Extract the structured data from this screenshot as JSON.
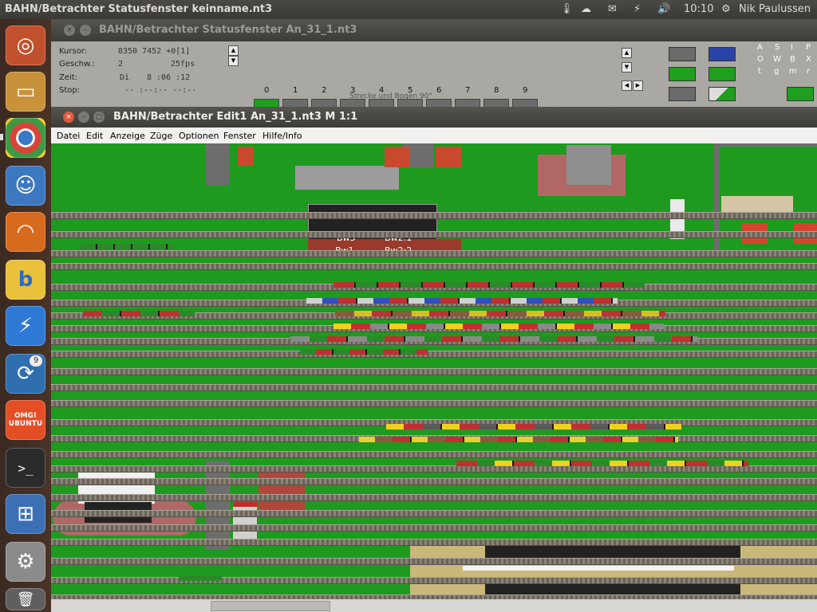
{
  "topbar": {
    "title": "BAHN/Betrachter Statusfenster keinname.nt3",
    "time": "10:10",
    "user": "Nik Paulussen"
  },
  "launcher": {
    "items": [
      {
        "name": "ubuntu-icon",
        "color": "#c1502c"
      },
      {
        "name": "files-icon",
        "color": "#c8923b"
      },
      {
        "name": "chrome-icon",
        "color": "#d9443a"
      },
      {
        "name": "mail-stamp-icon",
        "color": "#3c78c0"
      },
      {
        "name": "rss-icon",
        "color": "#d86a1e"
      },
      {
        "name": "b-app-icon",
        "color": "#e9c13b"
      },
      {
        "name": "bolt-app-icon",
        "color": "#2e79d4"
      },
      {
        "name": "chat-app-icon",
        "color": "#2f6fb0"
      },
      {
        "name": "omg-ubuntu-icon",
        "color": "#e54e24"
      },
      {
        "name": "terminal-icon",
        "color": "#2b2b2b"
      },
      {
        "name": "workspaces-icon",
        "color": "#3d6fb5"
      },
      {
        "name": "settings-icon",
        "color": "#8a8a8a"
      },
      {
        "name": "trash-icon",
        "color": "#5f5f5f"
      }
    ],
    "chat_badge": "9",
    "omg_label": "OMG! UBUNTU"
  },
  "statuswin": {
    "title": "BAHN/Betrachter Statusfenster An_31_1.nt3",
    "labels": {
      "kursor": "Kursor:",
      "geschw": "Geschw.:",
      "zeit": "Zeit:",
      "stop": "Stop:"
    },
    "values": {
      "kursor": "8350  7452 +0[1]",
      "geschw": "2",
      "fps": "25fps",
      "zeit_day": "Di",
      "zeit_time": "8 :06  :12",
      "stop": "-- :--:-- --:--"
    },
    "track_numbers": [
      "0",
      "1",
      "2",
      "3",
      "4",
      "5",
      "6",
      "7",
      "8",
      "9"
    ],
    "track_caption": "Strecke und Bogen 90°",
    "letters_row1": [
      "A",
      "S",
      "I",
      "P"
    ],
    "letters_row2": [
      "O",
      "W",
      "B",
      "X"
    ],
    "letters_row3": [
      "t",
      "g",
      "m",
      "r"
    ]
  },
  "editwin": {
    "title": "BAHN/Betrachter Edit1 An_31_1.nt3 M 1:1",
    "menu": [
      "Datei",
      "Edit",
      "Anzeige",
      "Züge",
      "Optionen",
      "Fenster",
      "Hilfe/Info"
    ],
    "depot_labels": {
      "bw3": "Bw3",
      "bw21": "Bw2:1",
      "bw1": "Bw1",
      "bw22": "Bw2:2"
    }
  }
}
